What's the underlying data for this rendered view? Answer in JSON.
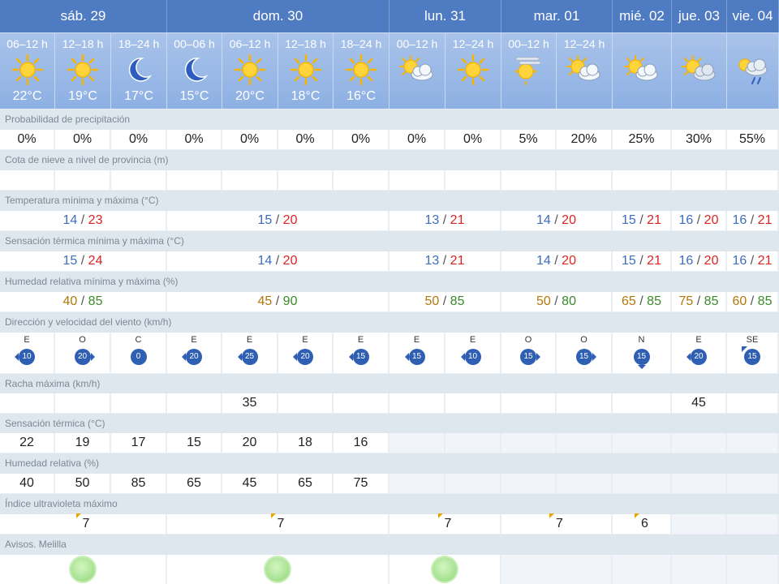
{
  "colors": {
    "day_header": "#4f7bc3",
    "period_header": "#a9c3ea",
    "row_label_bg": "#dfe7ee",
    "temp_min": "#3c6dbf",
    "temp_max": "#d22",
    "hum_min": "#b5770a",
    "hum_max": "#3a8a2a",
    "aviso_green": "#aee59a",
    "wind_badge": "#2f5fb3"
  },
  "days": [
    {
      "label": "sáb. 29"
    },
    {
      "label": "dom. 30"
    },
    {
      "label": "lun. 31"
    },
    {
      "label": "mar. 01"
    },
    {
      "label": "mié. 02"
    },
    {
      "label": "jue. 03"
    },
    {
      "label": "vie. 04"
    }
  ],
  "periods": [
    {
      "label": "06–12 h",
      "icon": "sun-icon",
      "temp": "22°C"
    },
    {
      "label": "12–18 h",
      "icon": "sun-icon",
      "temp": "19°C"
    },
    {
      "label": "18–24 h",
      "icon": "moon-icon",
      "temp": "17°C"
    },
    {
      "label": "00–06 h",
      "icon": "moon-icon",
      "temp": "15°C"
    },
    {
      "label": "06–12 h",
      "icon": "sun-icon",
      "temp": "20°C"
    },
    {
      "label": "12–18 h",
      "icon": "sun-icon",
      "temp": "18°C"
    },
    {
      "label": "18–24 h",
      "icon": "sun-icon",
      "temp": "16°C"
    },
    {
      "label": "00–12 h",
      "icon": "sun-cloud-icon",
      "temp": ""
    },
    {
      "label": "12–24 h",
      "icon": "sun-icon",
      "temp": ""
    },
    {
      "label": "00–12 h",
      "icon": "sun-haze-icon",
      "temp": ""
    },
    {
      "label": "12–24 h",
      "icon": "sun-cloud-icon",
      "temp": ""
    },
    {
      "label": "",
      "icon": "sun-cloud-icon",
      "temp": ""
    },
    {
      "label": "",
      "icon": "sun-overcast-icon",
      "temp": ""
    },
    {
      "label": "",
      "icon": "sun-rain-icon",
      "temp": ""
    }
  ],
  "labels": {
    "precip": "Probabilidad de precipitación",
    "snow": "Cota de nieve a nivel de provincia (m)",
    "temp_minmax": "Temperatura mínima y máxima (°C)",
    "feel_minmax": "Sensación térmica mínima y máxima (°C)",
    "hum_minmax": "Humedad relativa mínima y máxima (%)",
    "wind": "Dirección y velocidad del viento (km/h)",
    "gust": "Racha máxima (km/h)",
    "feel": "Sensación térmica (°C)",
    "hum": "Humedad relativa (%)",
    "uv": "Índice ultravioleta máximo",
    "avisos": "Avisos. Melilla"
  },
  "precip": [
    "0%",
    "0%",
    "0%",
    "0%",
    "0%",
    "0%",
    "0%",
    "0%",
    "0%",
    "5%",
    "20%",
    "25%",
    "30%",
    "55%"
  ],
  "temp_minmax": [
    {
      "min": "14",
      "max": "23"
    },
    {
      "min": "15",
      "max": "20"
    },
    {
      "min": "13",
      "max": "21"
    },
    {
      "min": "14",
      "max": "20"
    },
    {
      "min": "15",
      "max": "21"
    },
    {
      "min": "16",
      "max": "20"
    },
    {
      "min": "16",
      "max": "21"
    }
  ],
  "feel_minmax": [
    {
      "min": "15",
      "max": "24"
    },
    {
      "min": "14",
      "max": "20"
    },
    {
      "min": "13",
      "max": "21"
    },
    {
      "min": "14",
      "max": "20"
    },
    {
      "min": "15",
      "max": "21"
    },
    {
      "min": "16",
      "max": "20"
    },
    {
      "min": "16",
      "max": "21"
    }
  ],
  "hum_minmax": [
    {
      "min": "40",
      "max": "85"
    },
    {
      "min": "45",
      "max": "90"
    },
    {
      "min": "50",
      "max": "85"
    },
    {
      "min": "50",
      "max": "80"
    },
    {
      "min": "65",
      "max": "85"
    },
    {
      "min": "75",
      "max": "85"
    },
    {
      "min": "60",
      "max": "85"
    }
  ],
  "wind": [
    {
      "dir": "E",
      "speed": "10"
    },
    {
      "dir": "O",
      "speed": "20"
    },
    {
      "dir": "C",
      "speed": "0"
    },
    {
      "dir": "E",
      "speed": "20"
    },
    {
      "dir": "E",
      "speed": "25"
    },
    {
      "dir": "E",
      "speed": "20"
    },
    {
      "dir": "E",
      "speed": "15"
    },
    {
      "dir": "E",
      "speed": "15"
    },
    {
      "dir": "E",
      "speed": "10"
    },
    {
      "dir": "O",
      "speed": "15"
    },
    {
      "dir": "O",
      "speed": "15"
    },
    {
      "dir": "N",
      "speed": "15"
    },
    {
      "dir": "E",
      "speed": "20"
    },
    {
      "dir": "SE",
      "speed": "15"
    }
  ],
  "gust": [
    "",
    "",
    "",
    "",
    "35",
    "",
    "",
    "",
    "",
    "",
    "",
    "",
    "45",
    ""
  ],
  "feel": [
    "22",
    "19",
    "17",
    "15",
    "20",
    "18",
    "16"
  ],
  "hum": [
    "40",
    "50",
    "85",
    "65",
    "45",
    "65",
    "75"
  ],
  "uv": [
    "7",
    "7",
    "7",
    "7",
    "6"
  ]
}
